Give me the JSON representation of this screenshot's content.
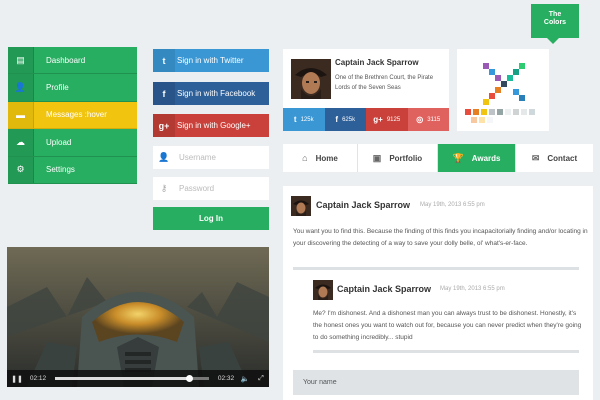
{
  "menu": {
    "items": [
      {
        "label": "Dashboard",
        "icon": "document-icon",
        "glyph": "▤"
      },
      {
        "label": "Profile",
        "icon": "user-icon",
        "glyph": "👤"
      },
      {
        "label": "Messages :hover",
        "icon": "message-icon",
        "glyph": "▬"
      },
      {
        "label": "Upload",
        "icon": "cloud-upload-icon",
        "glyph": "☁"
      },
      {
        "label": "Settings",
        "icon": "gear-icon",
        "glyph": "⚙"
      }
    ]
  },
  "social": {
    "twitter": {
      "label": "Sign in with Twitter",
      "glyph": "t"
    },
    "facebook": {
      "label": "Sign in with Facebook",
      "glyph": "f"
    },
    "google": {
      "label": "Sign in with Google+",
      "glyph": "g+"
    }
  },
  "login_form": {
    "username_placeholder": "Username",
    "password_placeholder": "Password",
    "login_label": "Log In"
  },
  "video": {
    "current_time": "02:12",
    "total_time": "02:32",
    "progress": 0.87
  },
  "profile": {
    "name": "Captain Jack Sparrow",
    "description": "One of the Brethren Court, the Pirate Lords of the Seven Seas",
    "stats": [
      {
        "icon": "twitter-icon",
        "glyph": "t",
        "value": "125k"
      },
      {
        "icon": "facebook-icon",
        "glyph": "f",
        "value": "625k"
      },
      {
        "icon": "google-plus-icon",
        "glyph": "g+",
        "value": "9125"
      },
      {
        "icon": "dribbble-icon",
        "glyph": "◎",
        "value": "3115"
      }
    ]
  },
  "colors_badge": {
    "line1": "The",
    "line2": "Colors"
  },
  "tabs": [
    {
      "label": "Home",
      "icon": "home-icon",
      "glyph": "⌂"
    },
    {
      "label": "Portfolio",
      "icon": "briefcase-icon",
      "glyph": "▣"
    },
    {
      "label": "Awards",
      "icon": "trophy-icon",
      "glyph": "🏆"
    },
    {
      "label": "Contact",
      "icon": "envelope-icon",
      "glyph": "✉"
    }
  ],
  "comments": [
    {
      "name": "Captain Jack Sparrow",
      "date": "May 19th, 2013 6:55 pm",
      "text": "You want you to find this. Because the finding of this finds you incapacitorially finding and/or locating in your discovering the detecting of a way to save your dolly belle, ol' what's-er-face."
    },
    {
      "name": "Captain Jack Sparrow",
      "date": "May 19th, 2013 6:55 pm",
      "text": "Me? I'm dishonest. And a dishonest man you can always trust to be dishonest. Honestly, it's the honest ones you want to watch out for, because you can never predict when they're going to do something incredibly... stupid"
    }
  ],
  "reply_form": {
    "name_placeholder": "Your name"
  },
  "colors": {
    "green": "#27ae60",
    "yellow": "#f1c40f",
    "twitter": "#3a97d3",
    "facebook": "#2d5f99",
    "google": "#c9413a"
  }
}
